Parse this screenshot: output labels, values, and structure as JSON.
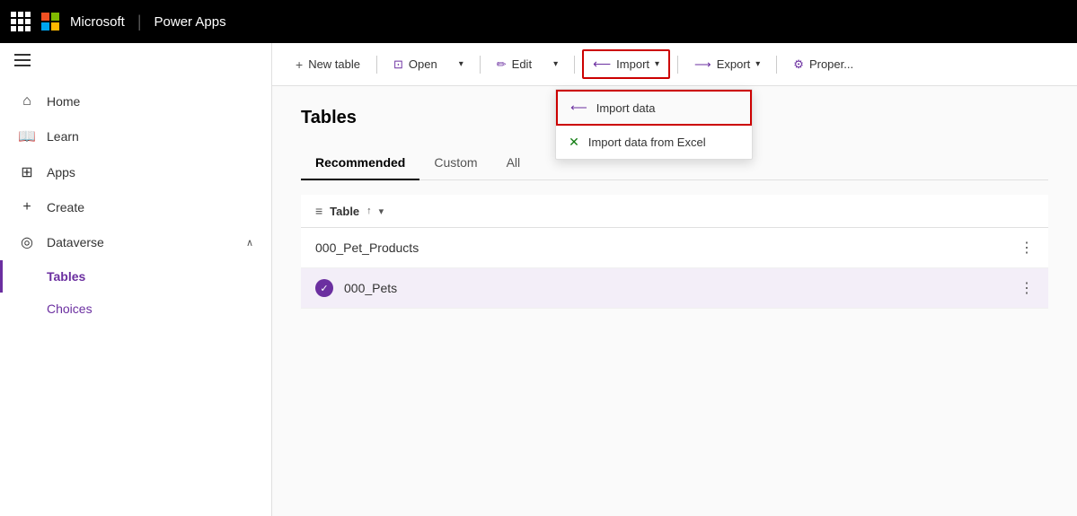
{
  "topbar": {
    "brand": "Power Apps",
    "microsoft_label": "Microsoft"
  },
  "sidebar": {
    "hamburger_label": "menu",
    "items": [
      {
        "id": "home",
        "label": "Home",
        "icon": "⌂"
      },
      {
        "id": "learn",
        "label": "Learn",
        "icon": "📖"
      },
      {
        "id": "apps",
        "label": "Apps",
        "icon": "⊞"
      },
      {
        "id": "create",
        "label": "Create",
        "icon": "+"
      },
      {
        "id": "dataverse",
        "label": "Dataverse",
        "icon": "◎"
      }
    ],
    "dataverse_children": [
      {
        "id": "tables",
        "label": "Tables",
        "active": true
      },
      {
        "id": "choices",
        "label": "Choices",
        "active": false
      }
    ]
  },
  "toolbar": {
    "new_table_label": "New table",
    "open_label": "Open",
    "edit_label": "Edit",
    "import_label": "Import",
    "export_label": "Export",
    "properties_label": "Proper..."
  },
  "dropdown": {
    "import_data_label": "Import data",
    "import_excel_label": "Import data from Excel"
  },
  "page": {
    "title": "Tables",
    "tabs": [
      {
        "id": "recommended",
        "label": "Recommended",
        "active": true
      },
      {
        "id": "custom",
        "label": "Custom",
        "active": false
      },
      {
        "id": "all",
        "label": "All",
        "active": false
      }
    ],
    "table_col_label": "Table",
    "rows": [
      {
        "id": "row1",
        "name": "000_Pet_Products",
        "selected": false
      },
      {
        "id": "row2",
        "name": "000_Pets",
        "selected": true
      }
    ]
  }
}
